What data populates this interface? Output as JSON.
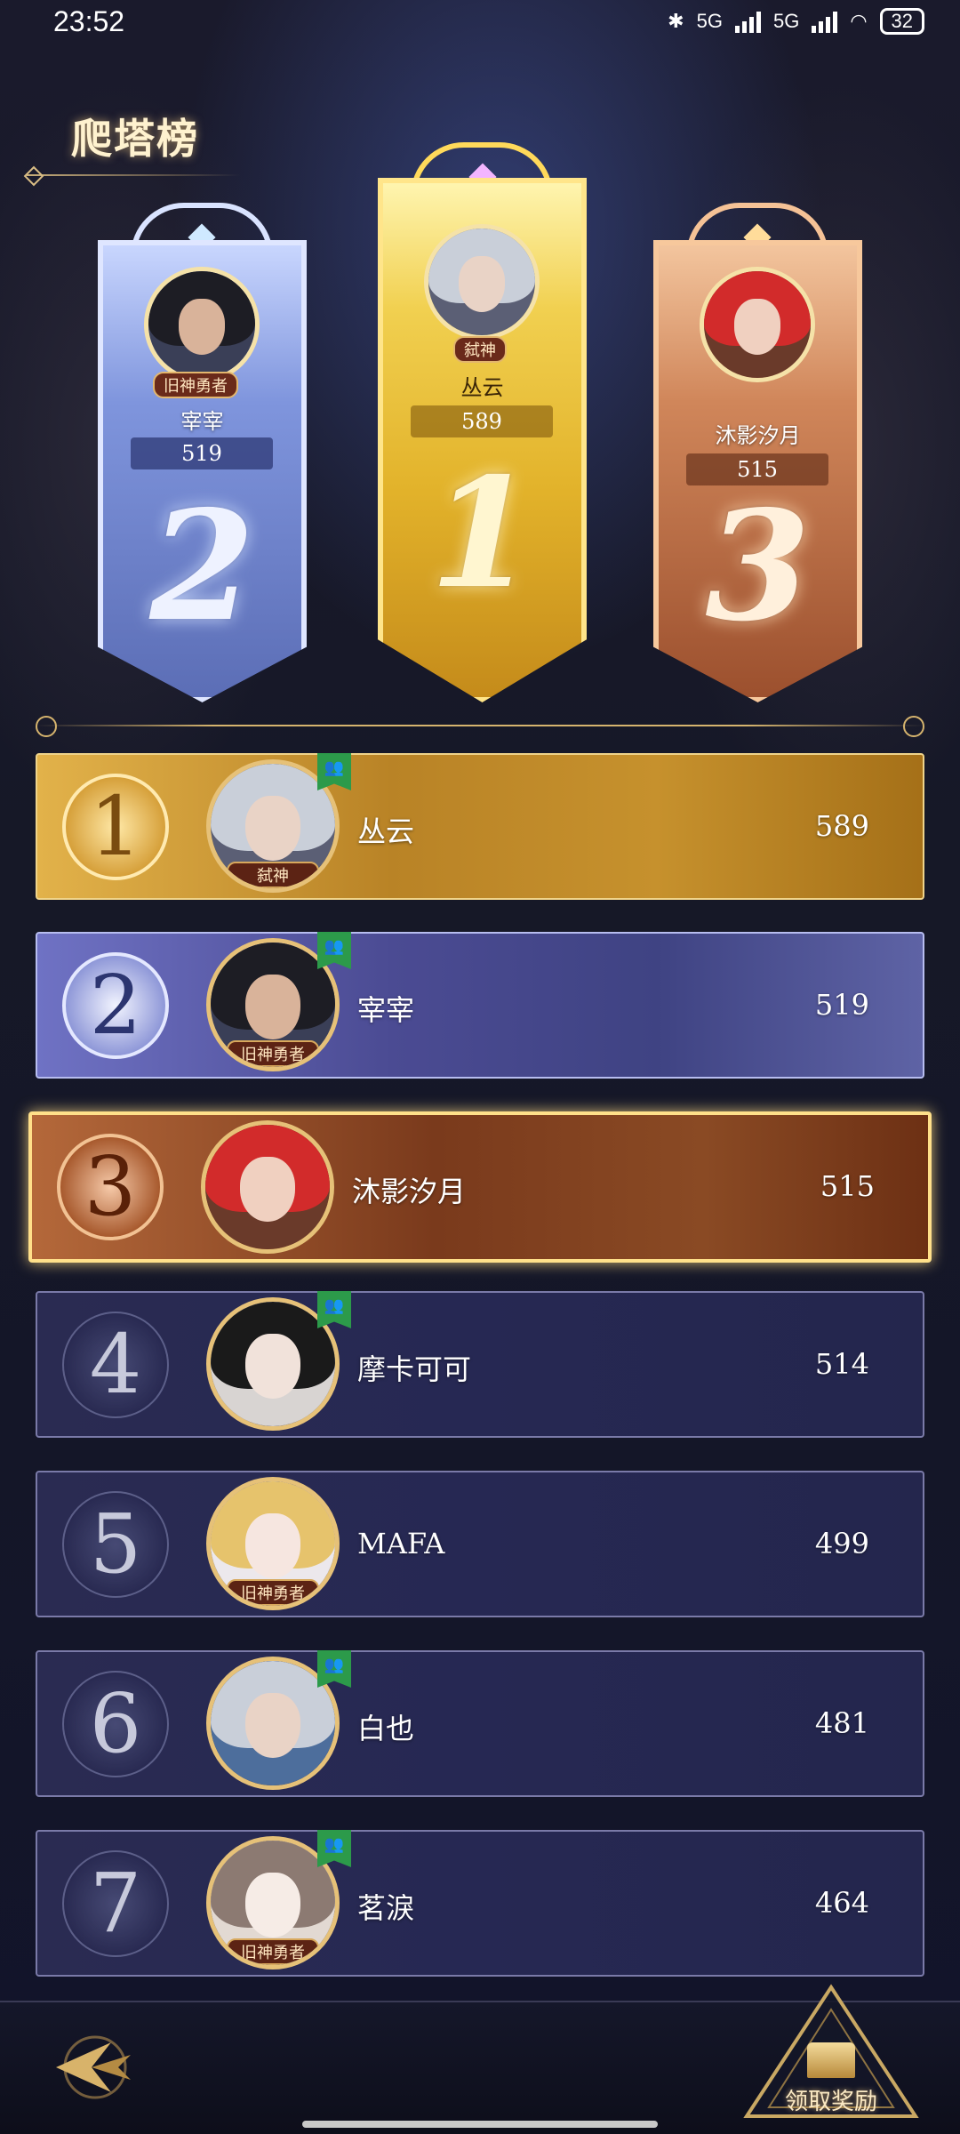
{
  "status_bar": {
    "time": "23:52",
    "network_1": "5G",
    "network_2": "5G",
    "battery": "32"
  },
  "header": {
    "title": "爬塔榜"
  },
  "podium": [
    {
      "rank": "2",
      "name": "宰宰",
      "score": "519",
      "tag": "旧神勇者",
      "color": "#7f95dd"
    },
    {
      "rank": "1",
      "name": "丛云",
      "score": "589",
      "tag": "弑神",
      "color": "#e2b22a"
    },
    {
      "rank": "3",
      "name": "沐影汐月",
      "score": "515",
      "tag": "",
      "color": "#d0865a"
    }
  ],
  "rows": [
    {
      "rank": "1",
      "name": "丛云",
      "score": "589",
      "tag": "弑神",
      "friend": true
    },
    {
      "rank": "2",
      "name": "宰宰",
      "score": "519",
      "tag": "旧神勇者",
      "friend": true
    },
    {
      "rank": "3",
      "name": "沐影汐月",
      "score": "515",
      "tag": "",
      "friend": false
    },
    {
      "rank": "4",
      "name": "摩卡可可",
      "score": "514",
      "tag": "",
      "friend": true
    },
    {
      "rank": "5",
      "name": "MAFA",
      "score": "499",
      "tag": "旧神勇者",
      "friend": false
    },
    {
      "rank": "6",
      "name": "白也",
      "score": "481",
      "tag": "",
      "friend": true
    },
    {
      "rank": "7",
      "name": "茗淚",
      "score": "464",
      "tag": "旧神勇者",
      "friend": true
    }
  ],
  "bottom": {
    "back_icon": "back-arrow-icon",
    "reward_label": "领取奖励",
    "reward_icon": "treasure-chest-icon"
  }
}
